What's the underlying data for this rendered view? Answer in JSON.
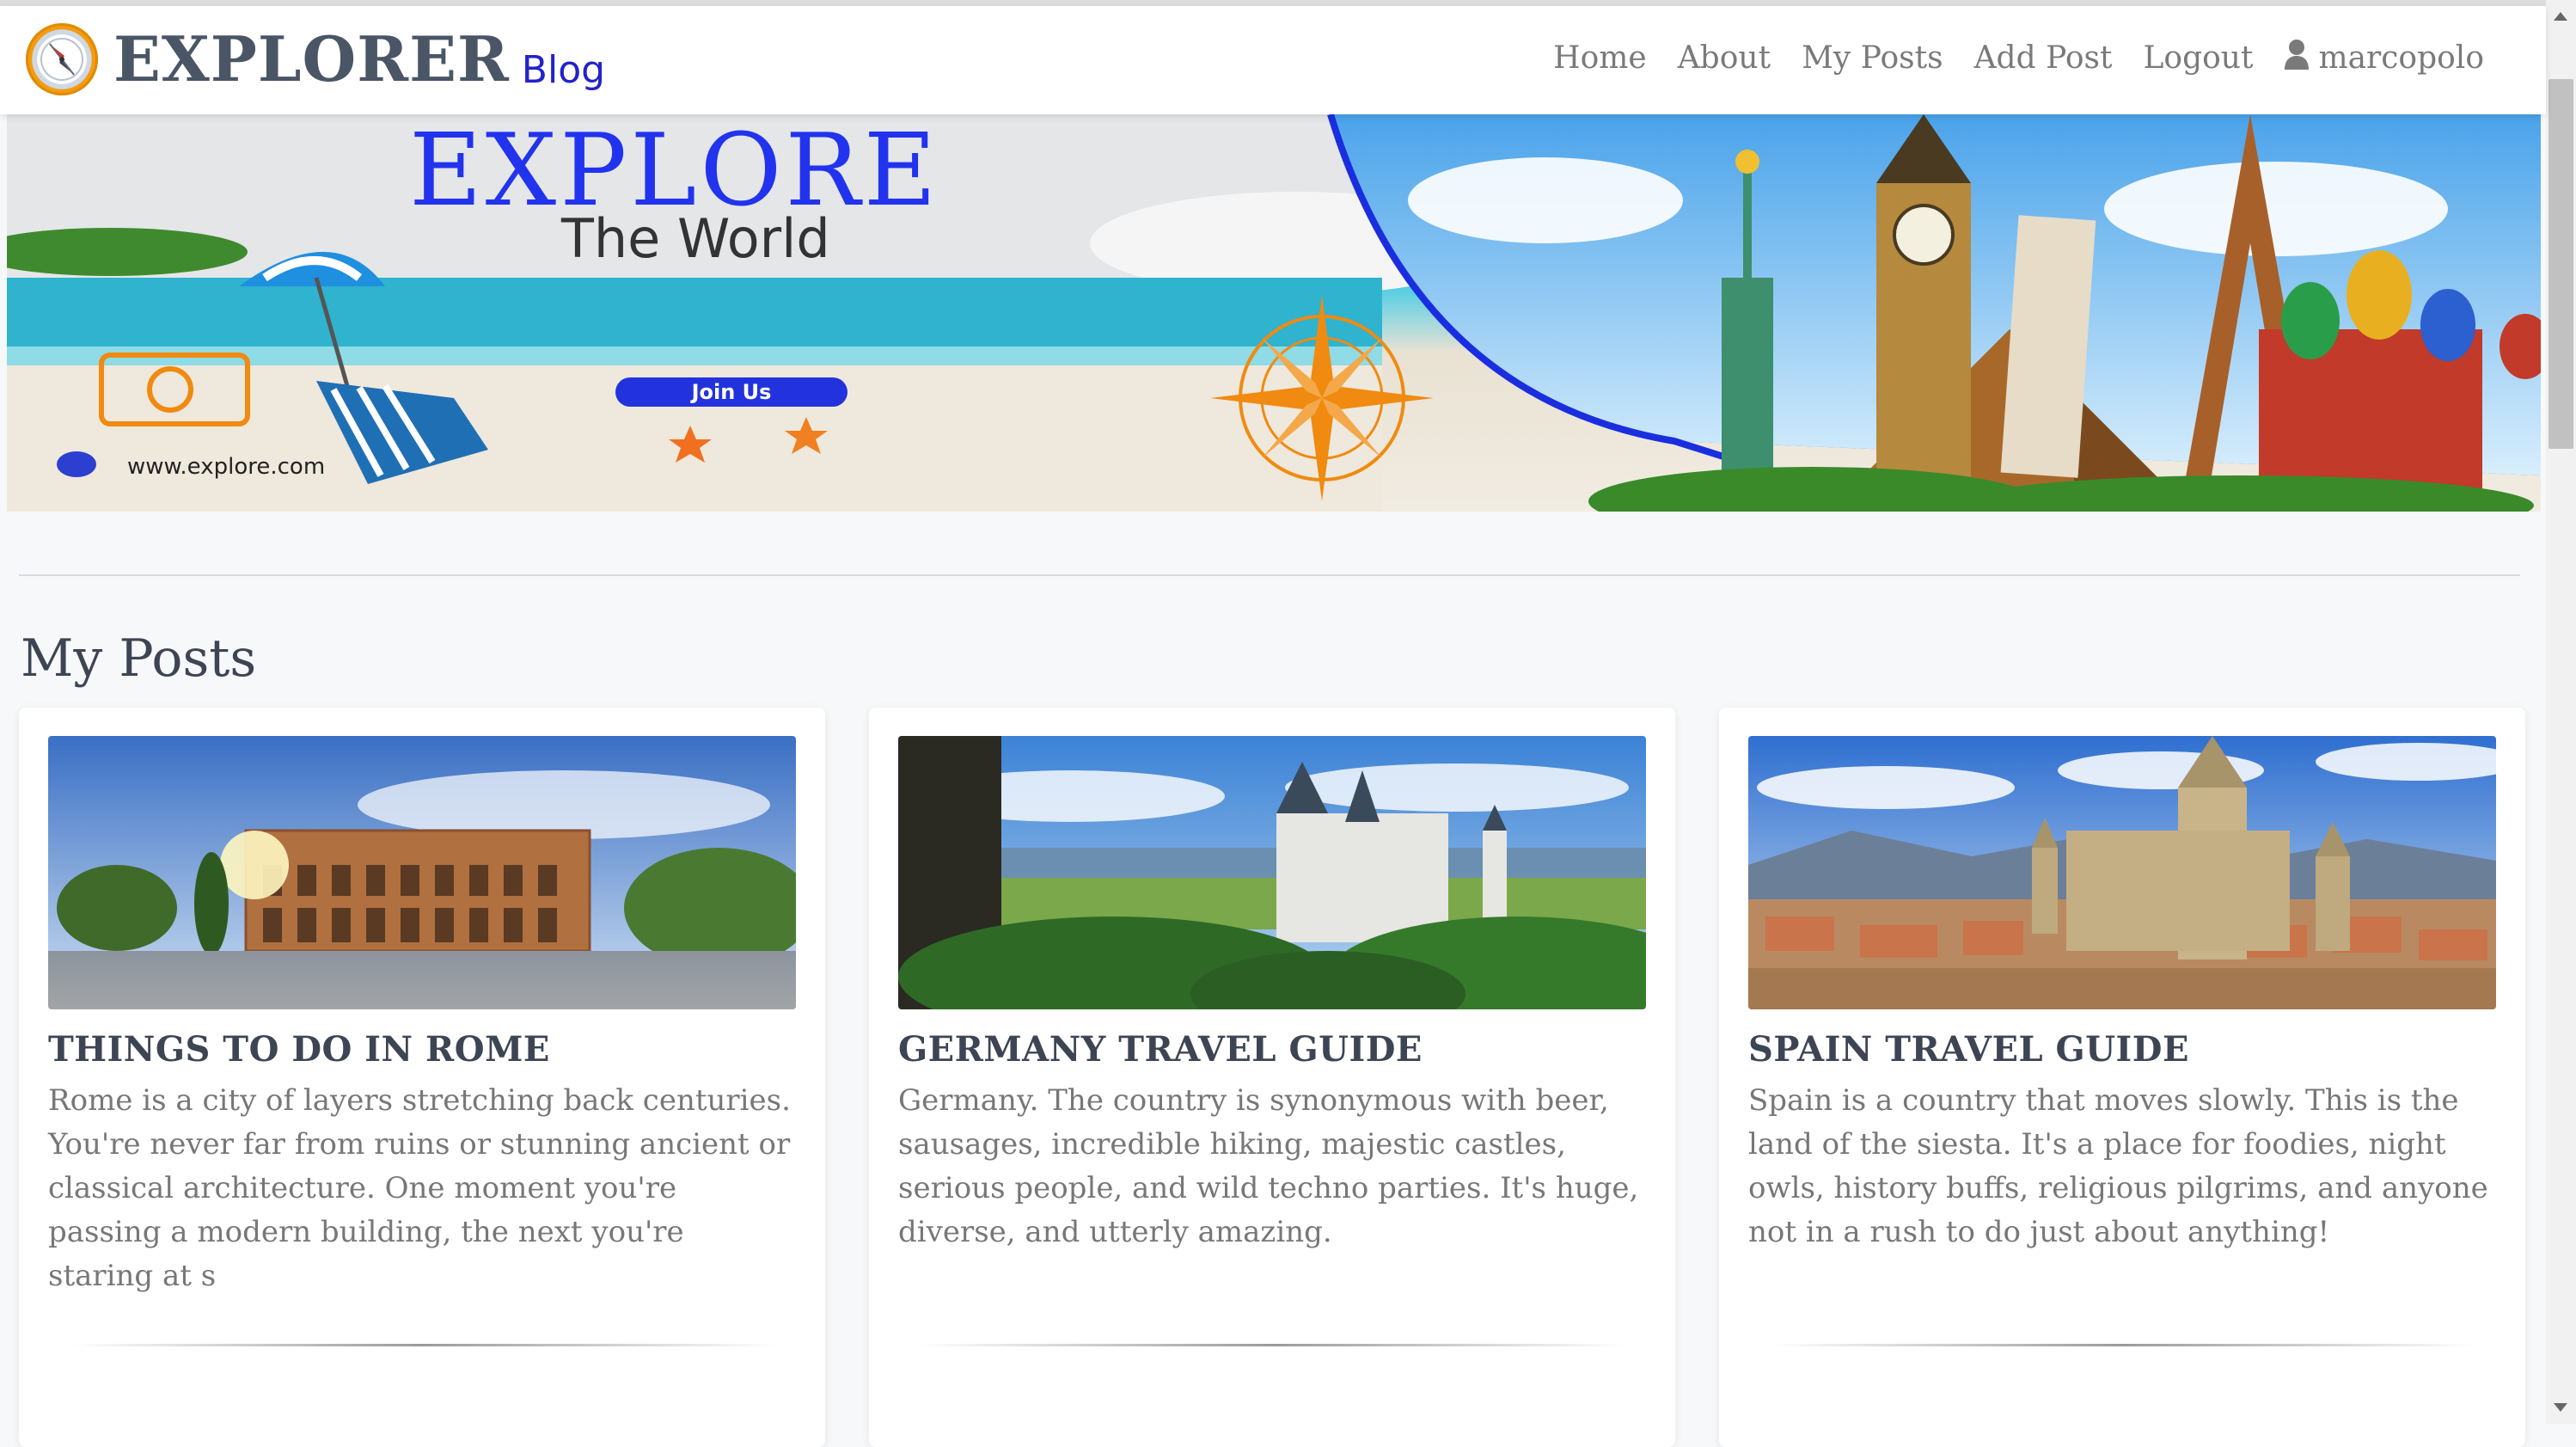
{
  "navbar": {
    "brand_title": "EXPLORER",
    "brand_sub": "Blog",
    "links": [
      "Home",
      "About",
      "My Posts",
      "Add Post",
      "Logout"
    ],
    "username": "marcopolo"
  },
  "hero": {
    "title": "EXPLORE",
    "subtitle": "The World",
    "join_button": "Join Us",
    "url": "www.explore.com"
  },
  "section": {
    "title": "My Posts"
  },
  "posts": [
    {
      "title": "THINGS TO DO IN ROME",
      "excerpt": "Rome is a city of layers stretching back centuries. You're never far from ruins or stunning ancient or classical architecture. One moment you're passing a modern building, the next you're staring at s"
    },
    {
      "title": "GERMANY TRAVEL GUIDE",
      "excerpt": "Germany. The country is synonymous with beer, sausages, incredible hiking, majestic castles, serious people, and wild techno parties. It's huge, diverse, and utterly amazing."
    },
    {
      "title": "SPAIN TRAVEL GUIDE",
      "excerpt": "Spain is a country that moves slowly. This is the land of the siesta. It's a place for foodies, night owls, history buffs, religious pilgrims, and anyone not in a rush to do just about anything!"
    }
  ],
  "colors": {
    "brand_blue": "#2233ee",
    "title_gray": "#3d4554",
    "nav_gray": "#7a7a7a",
    "compass_orange": "#f39c12"
  },
  "icons": {
    "logo": "compass-icon",
    "user": "user-icon"
  }
}
